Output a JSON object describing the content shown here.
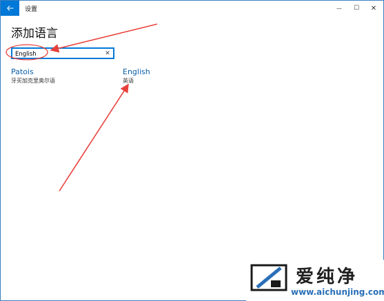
{
  "window": {
    "app_title": "设置",
    "back_icon": "back-arrow-icon",
    "minimize_glyph": "—",
    "maximize_glyph": "☐",
    "close_glyph": "✕"
  },
  "page": {
    "title": "添加语言"
  },
  "search": {
    "value": "English",
    "clear_glyph": "✕"
  },
  "results": [
    {
      "name": "Patois",
      "native": "牙买加克里奥尔语"
    },
    {
      "name": "English",
      "native": "英语"
    }
  ],
  "watermark": {
    "chinese": "爱纯净",
    "url": "www.aichunjing.com"
  },
  "colors": {
    "accent": "#0078d7",
    "link": "#0a5fa8",
    "annotation": "#e8413c"
  }
}
